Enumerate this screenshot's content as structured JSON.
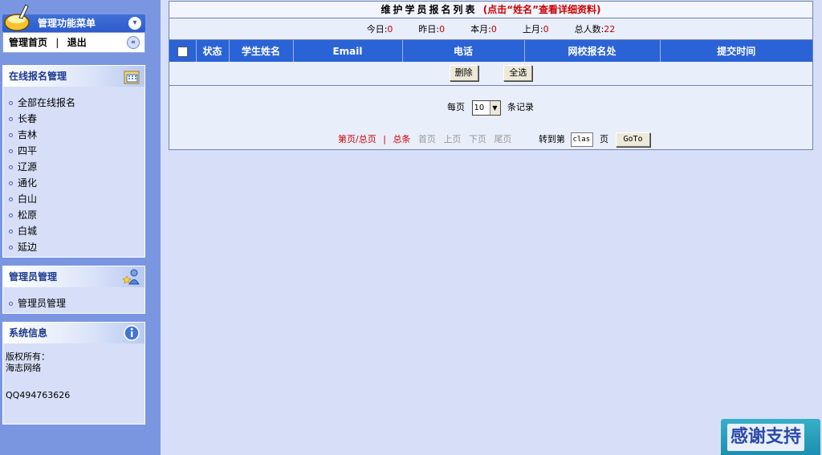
{
  "sidebar": {
    "menu_title": "管理功能菜单",
    "quick_links": {
      "home": "管理首页",
      "sep": "|",
      "logout": "退出"
    },
    "registration_panel": {
      "title": "在线报名管理",
      "items": [
        "全部在线报名",
        "长春",
        "吉林",
        "四平",
        "辽源",
        "通化",
        "白山",
        "松原",
        "白城",
        "延边"
      ]
    },
    "admin_panel": {
      "title": "管理员管理",
      "items": [
        "管理员管理"
      ]
    },
    "system_panel": {
      "title": "系统信息",
      "lines": [
        "版权所有：",
        "海志网络",
        "QQ494763626"
      ]
    }
  },
  "main": {
    "title": "维护学员报名列表",
    "title_hint": "(点击“姓名”查看详细资料)",
    "stats": [
      {
        "label": "今日:",
        "value": "0"
      },
      {
        "label": "昨日:",
        "value": "0"
      },
      {
        "label": "本月:",
        "value": "0"
      },
      {
        "label": "上月:",
        "value": "0"
      },
      {
        "label": "总人数:",
        "value": "22"
      }
    ],
    "columns": [
      "状态",
      "学生姓名",
      "Email",
      "电话",
      "网校报名处",
      "提交时间"
    ],
    "actions": {
      "delete": "删除",
      "select_all": "全选"
    },
    "pager": {
      "per_page_label": "每页",
      "per_page_value": "10",
      "per_page_suffix": "条记录",
      "page_total": "第页/总页",
      "sep": "|",
      "total_records": "总条",
      "first": "首页",
      "prev": "上页",
      "next": "下页",
      "last": "尾页",
      "goto_label": "转到第",
      "goto_value": "clas",
      "goto_suffix": "页",
      "goto_button": "GoTo"
    }
  },
  "badge": {
    "text": "感谢支持"
  },
  "colors": {
    "header_blue": "#2a63d6",
    "sidebar_blue": "#7b96e0",
    "background": "#d6dff7",
    "accent_red": "#cc0000"
  }
}
